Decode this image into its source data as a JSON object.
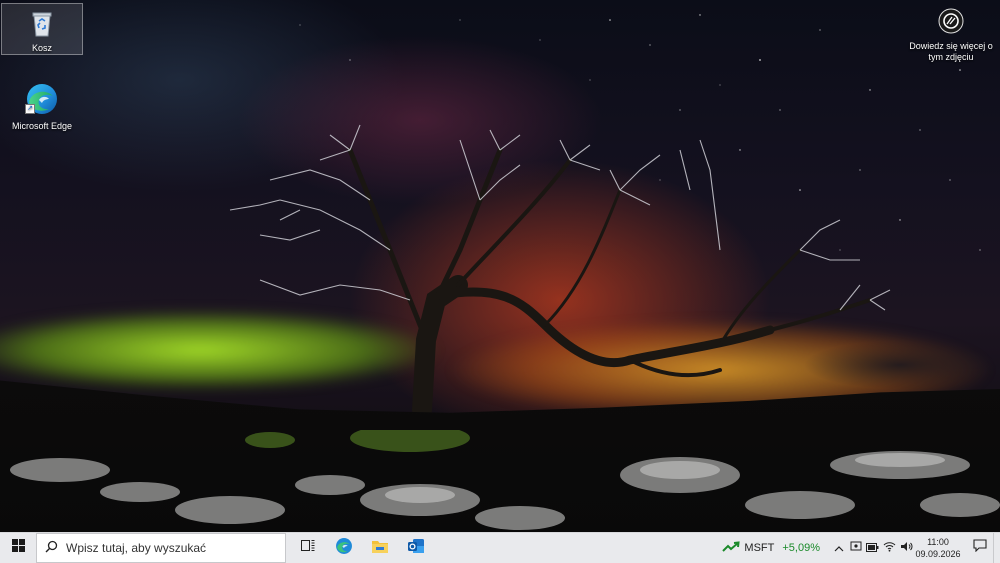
{
  "desktop": {
    "icons": [
      {
        "label": "Kosz",
        "icon": "recycle-bin-icon"
      },
      {
        "label": "Microsoft Edge",
        "icon": "edge-icon"
      }
    ],
    "learn_more": {
      "label": "Dowiedz się więcej o tym zdjęciu",
      "icon": "camera-icon"
    }
  },
  "taskbar": {
    "search_placeholder": "Wpisz tutaj, aby wyszukać",
    "apps": [
      "task-view-icon",
      "edge-icon",
      "file-explorer-icon",
      "outlook-icon"
    ],
    "stock": {
      "symbol": "MSFT",
      "change": "+5,09%",
      "color": "#1a8a2a"
    },
    "tray": [
      "chevron-up-icon",
      "meet-now-icon",
      "battery-icon",
      "wifi-icon",
      "volume-icon"
    ],
    "clock": {
      "time": "11:00",
      "date": "09.09.2026"
    }
  }
}
